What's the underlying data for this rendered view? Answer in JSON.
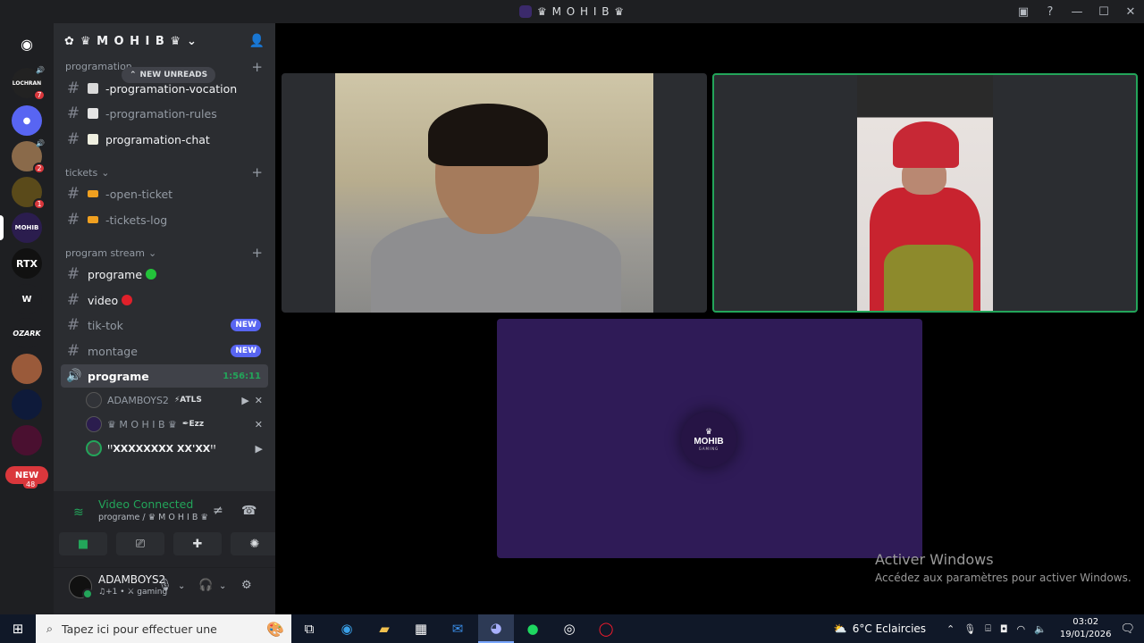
{
  "window": {
    "title": "♛ M O H I B ♛",
    "controls": {
      "minimize": "—",
      "maximize": "☐",
      "close": "✕"
    }
  },
  "rail": {
    "badges": [
      "7",
      "2",
      "1"
    ],
    "home_label": "Discord",
    "servers": [
      "LOCHRAN",
      "MOHIB",
      "RTX",
      "W",
      "OZARK"
    ],
    "new_label": "NEW",
    "new_count": "48"
  },
  "server": {
    "name": "♛ M O H I B ♛",
    "new_unreads": "NEW UNREADS"
  },
  "categories": [
    {
      "name": "programation"
    },
    {
      "name": "tickets"
    },
    {
      "name": "program stream"
    }
  ],
  "channels": {
    "prog_vocation": "-programation-vocation",
    "prog_rules": "-programation-rules",
    "prog_chat": "programation-chat",
    "open_ticket": "-open-ticket",
    "tickets_log": "-tickets-log",
    "programe": "programe",
    "video": "video",
    "tiktok": "tik-tok",
    "tiktok_tag": "NEW",
    "montage": "montage",
    "montage_tag": "NEW",
    "voice_programe": "programe",
    "voice_timer": "1:56:11"
  },
  "voice_users": [
    {
      "name": "ADAMBOYS2",
      "tag": "⚡ATLS"
    },
    {
      "name": "♛ M O H I B ♛",
      "tag": "✒Ezz"
    },
    {
      "name": "ꜝꜝ𝗫𝗫𝗫𝗫𝗫𝗫𝗫𝗫 𝗫𝗫'𝗫𝗫ꜝꜝ",
      "tag": ""
    }
  ],
  "voice_panel": {
    "status": "Video Connected",
    "location": "programe / ♛ M O H I B ♛"
  },
  "user_panel": {
    "name": "ADAMBOYS2",
    "status": "♫+1 • ⚔ gaming"
  },
  "stage": {
    "logo_text": "MOHIB",
    "logo_sub": "GAMING"
  },
  "watermark": {
    "line1": "Activer Windows",
    "line2": "Accédez aux paramètres pour activer Windows."
  },
  "taskbar": {
    "search_placeholder": "Tapez ici pour effectuer une",
    "weather": "6°C  Eclaircies",
    "time": "03:02",
    "date": "19/01/2026"
  },
  "colors": {
    "accent_green": "#23a55a",
    "blurple": "#5865f2",
    "danger": "#da373c",
    "screen_purple": "#2f1b57"
  }
}
